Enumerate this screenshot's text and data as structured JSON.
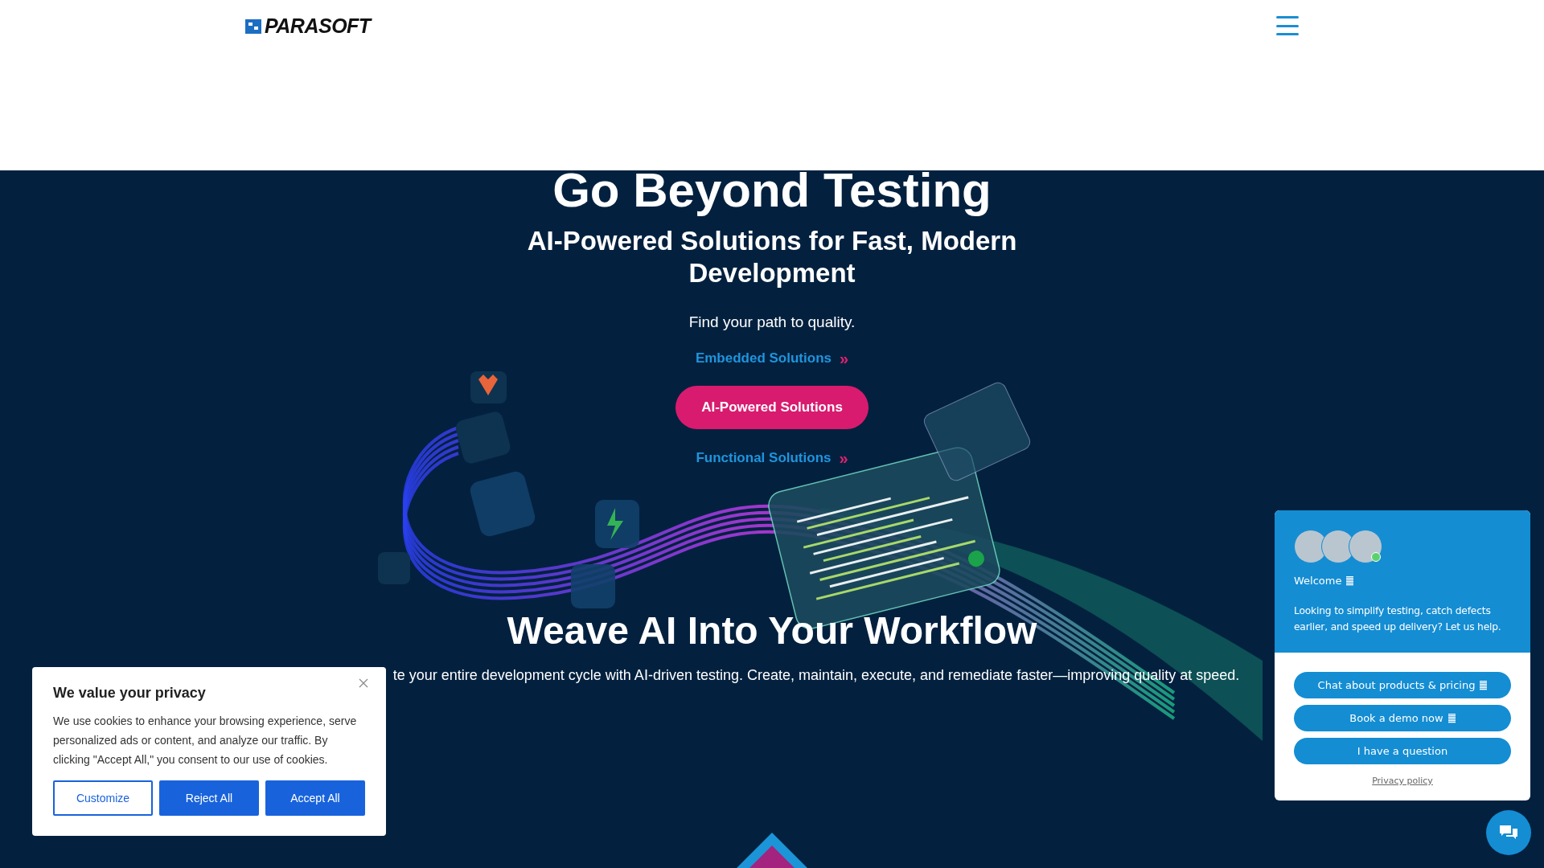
{
  "header": {
    "logo_text": "PARASOFT"
  },
  "hero": {
    "title": "Go Beyond Testing",
    "subtitle": "AI-Powered Solutions for Fast, Modern Development",
    "tagline": "Find your path to quality.",
    "links": [
      {
        "kind": "link",
        "label": "Embedded Solutions",
        "chevron": "»"
      },
      {
        "kind": "button",
        "label": "AI-Powered Solutions"
      },
      {
        "kind": "link",
        "label": "Functional Solutions",
        "chevron": "»"
      }
    ],
    "section_title": "Weave AI Into Your Workflow",
    "section_text": "te your entire development cycle with AI-driven testing. Create, maintain, execute, and remediate faster—improving quality at speed."
  },
  "cookie_banner": {
    "title": "We value your privacy",
    "text": "We use cookies to enhance your browsing experience, serve personalized ads or content, and analyze our traffic. By clicking \"Accept All,\" you consent to our use of cookies.",
    "buttons": [
      {
        "label": "Customize",
        "kind": "outline"
      },
      {
        "label": "Reject All",
        "kind": "solid"
      },
      {
        "label": "Accept All",
        "kind": "solid"
      }
    ]
  },
  "chat_widget": {
    "online": true,
    "greeting": "Welcome",
    "message": "Looking to simplify testing, catch defects earlier, and speed up delivery? Let us help.",
    "options": [
      {
        "label": "Chat about products & pricing",
        "icon": true
      },
      {
        "label": "Book a demo now",
        "icon": true
      },
      {
        "label": "I have a question",
        "icon": false
      }
    ],
    "privacy_link": "Privacy policy"
  }
}
